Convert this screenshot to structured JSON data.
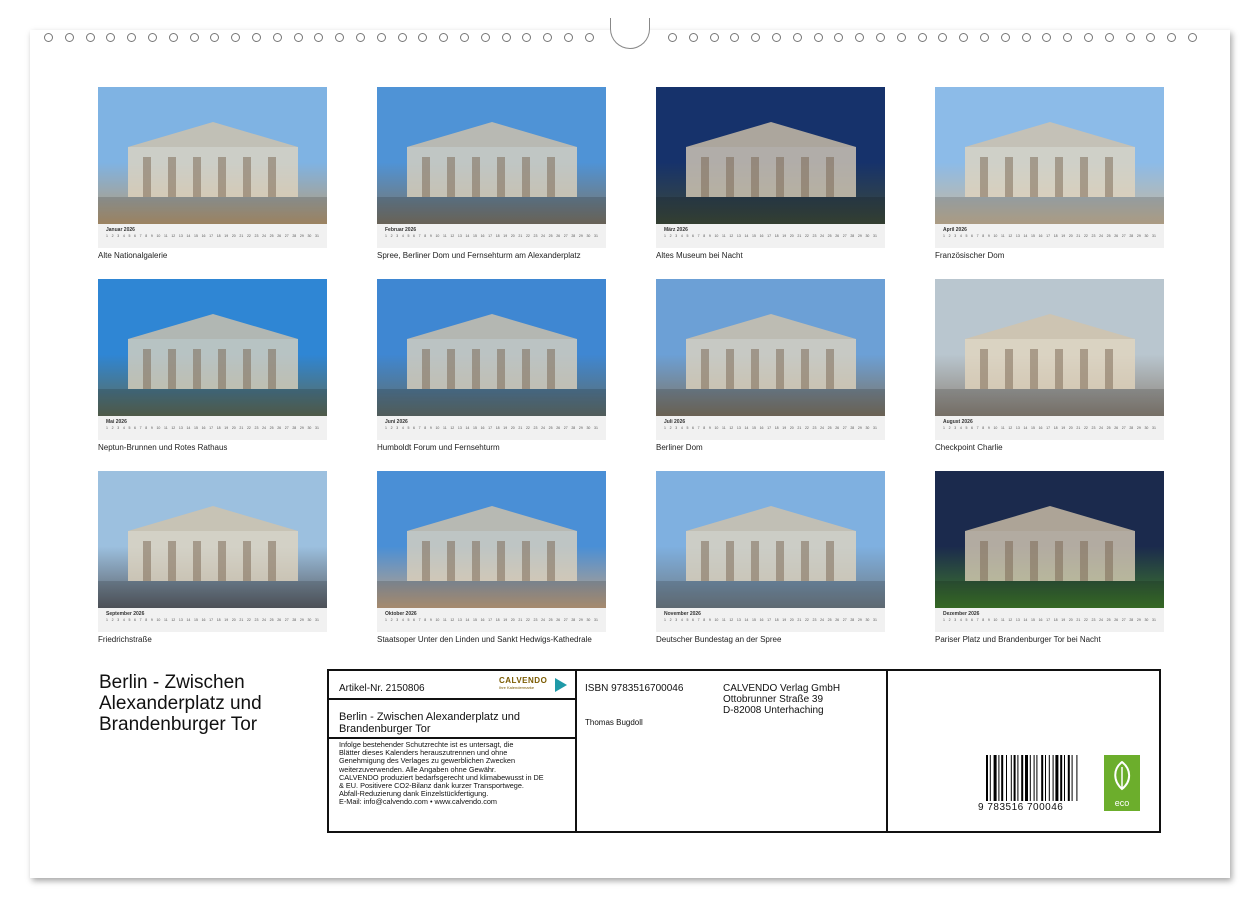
{
  "calendar_title": "Berlin - Zwischen Alexanderplatz und Brandenburger Tor",
  "title_lines": [
    "Berlin - Zwischen",
    "Alexanderplatz und",
    "Brandenburger Tor"
  ],
  "months": [
    {
      "month": "Januar 2026",
      "caption": "Alte Nationalgalerie",
      "sky": "#7fb3e3",
      "ground": "#b79a72"
    },
    {
      "month": "Februar 2026",
      "caption": "Spree, Berliner Dom und Fernsehturm am Alexanderplatz",
      "sky": "#4f93d6",
      "ground": "#7b7466"
    },
    {
      "month": "März 2026",
      "caption": "Altes Museum bei Nacht",
      "sky": "#16326b",
      "ground": "#3d4a3a"
    },
    {
      "month": "April 2026",
      "caption": "Französischer Dom",
      "sky": "#8cbbe8",
      "ground": "#c9b79a"
    },
    {
      "month": "Mai 2026",
      "caption": "Neptun-Brunnen und Rotes Rathaus",
      "sky": "#2f86d4",
      "ground": "#5d6a55"
    },
    {
      "month": "Juni 2026",
      "caption": "Humboldt Forum und Fernsehturm",
      "sky": "#3f87d2",
      "ground": "#5f6d6a"
    },
    {
      "month": "Juli 2026",
      "caption": "Berliner Dom",
      "sky": "#6ca0d6",
      "ground": "#7d7362"
    },
    {
      "month": "August 2026",
      "caption": "Checkpoint Charlie",
      "sky": "#b9c6cf",
      "ground": "#8a8278"
    },
    {
      "month": "September 2026",
      "caption": "Friedrichstraße",
      "sky": "#9cc0df",
      "ground": "#5a5f66"
    },
    {
      "month": "Oktober 2026",
      "caption": "Staatsoper Unter den Linden und Sankt Hedwigs-Kathedrale",
      "sky": "#4a8fd6",
      "ground": "#c3a281"
    },
    {
      "month": "November 2026",
      "caption": "Deutscher Bundestag an der Spree",
      "sky": "#7fb0e0",
      "ground": "#6f7c86"
    },
    {
      "month": "Dezember 2026",
      "caption": "Pariser Platz und Brandenburger Tor bei Nacht",
      "sky": "#1b2a4d",
      "ground": "#3f7a2a"
    }
  ],
  "info": {
    "artikel": "Artikel-Nr. 2150806",
    "logo_text": "CALVENDO",
    "logo_sub": "Ihre Kalendermarke",
    "title": "Berlin - Zwischen Alexanderplatz und Brandenburger Tor",
    "legal": [
      "Infolge bestehender Schutzrechte ist es untersagt, die",
      "Blätter dieses Kalenders herauszutrennen und ohne",
      "Genehmigung des Verlages zu gewerblichen Zwecken",
      "weiterzuverwenden. Alle Angaben ohne Gewähr.",
      "CALVENDO produziert bedarfsgerecht und klimabewusst in DE",
      "& EU. Positivere CO2-Bilanz dank kurzer Transportwege.",
      "Abfall-Reduzierung dank Einzelstückfertigung.",
      "E-Mail: info@calvendo.com • www.calvendo.com"
    ],
    "isbn": "ISBN 9783516700046",
    "author": "Thomas Bugdoll",
    "publisher": [
      "CALVENDO Verlag GmbH",
      "Ottobrunner Straße 39",
      "D-82008 Unterhaching"
    ],
    "barcode_number": "9 783516 700046",
    "eco_label": "eco"
  },
  "colors": {
    "eco_green": "#6cae2c",
    "logo_teal": "#1f9aa8"
  }
}
